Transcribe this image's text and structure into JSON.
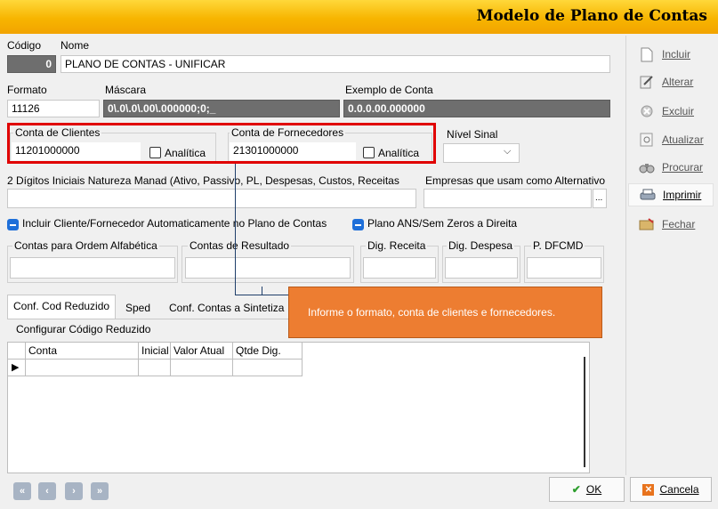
{
  "window": {
    "title": "Modelo de Plano de Contas"
  },
  "header": {
    "codigo_label": "Código",
    "codigo_value": "0",
    "nome_label": "Nome",
    "nome_value": "PLANO DE CONTAS - UNIFICAR"
  },
  "format_row": {
    "formato_label": "Formato",
    "formato_value": "11126",
    "mascara_label": "Máscara",
    "mascara_value": "0\\.0\\.0\\.00\\.000000;0;_",
    "exemplo_label": "Exemplo de Conta",
    "exemplo_value": "0.0.0.00.000000"
  },
  "accounts": {
    "clientes_label": "Conta de Clientes",
    "clientes_value": "11201000000",
    "clientes_analitica": "Analítica",
    "fornecedores_label": "Conta de Fornecedores",
    "fornecedores_value": "21301000000",
    "fornecedores_analitica": "Analítica",
    "nivel_label": "Nível Sinal",
    "nivel_value": ""
  },
  "natureza": {
    "label": "2 Dígitos Iniciais Natureza Manad (Ativo, Passivo, PL, Despesas, Custos, Receitas",
    "empresas_label": "Empresas que usam como Alternativo",
    "ellipsis": "..."
  },
  "options": {
    "incluir_label": "Incluir Cliente/Fornecedor Automaticamente no Plano de Contas",
    "plano_ans_label": "Plano ANS/Sem Zeros a Direita"
  },
  "contas_row": {
    "ordem_label": "Contas para Ordem Alfabética",
    "resultado_label": "Contas de Resultado",
    "receita_label": "Dig. Receita",
    "despesa_label": "Dig. Despesa",
    "dfcmd_label": "P. DFCMD"
  },
  "tabs": [
    {
      "label": "Conf. Cod Reduzido"
    },
    {
      "label": "Sped"
    },
    {
      "label": "Conf. Contas a Sintetiza"
    }
  ],
  "grid": {
    "group_label": "Configurar Código Reduzido",
    "columns": [
      "Conta",
      "Inicial",
      "Valor Atual",
      "Qtde Dig."
    ],
    "row_marker": "▶"
  },
  "callout": {
    "text": "Informe o formato, conta de clientes e fornecedores."
  },
  "sidebar": {
    "items": [
      {
        "label": "Incluir",
        "icon": "document-icon"
      },
      {
        "label": "Alterar",
        "icon": "edit-icon"
      },
      {
        "label": "Excluir",
        "icon": "delete-icon"
      },
      {
        "label": "Atualizar",
        "icon": "refresh-icon"
      },
      {
        "label": "Procurar",
        "icon": "binoculars-icon"
      },
      {
        "label": "Imprimir",
        "icon": "printer-icon"
      },
      {
        "label": "Fechar",
        "icon": "close-folder-icon"
      }
    ]
  },
  "footer": {
    "nav": [
      "«",
      "‹",
      "›",
      "»"
    ],
    "ok_label": "OK",
    "cancel_label": "Cancela"
  },
  "colors": {
    "titlebar": "#f7b500",
    "callout": "#ed7d31",
    "highlight": "#e00000",
    "checkbox_blue": "#1e6fd9"
  }
}
